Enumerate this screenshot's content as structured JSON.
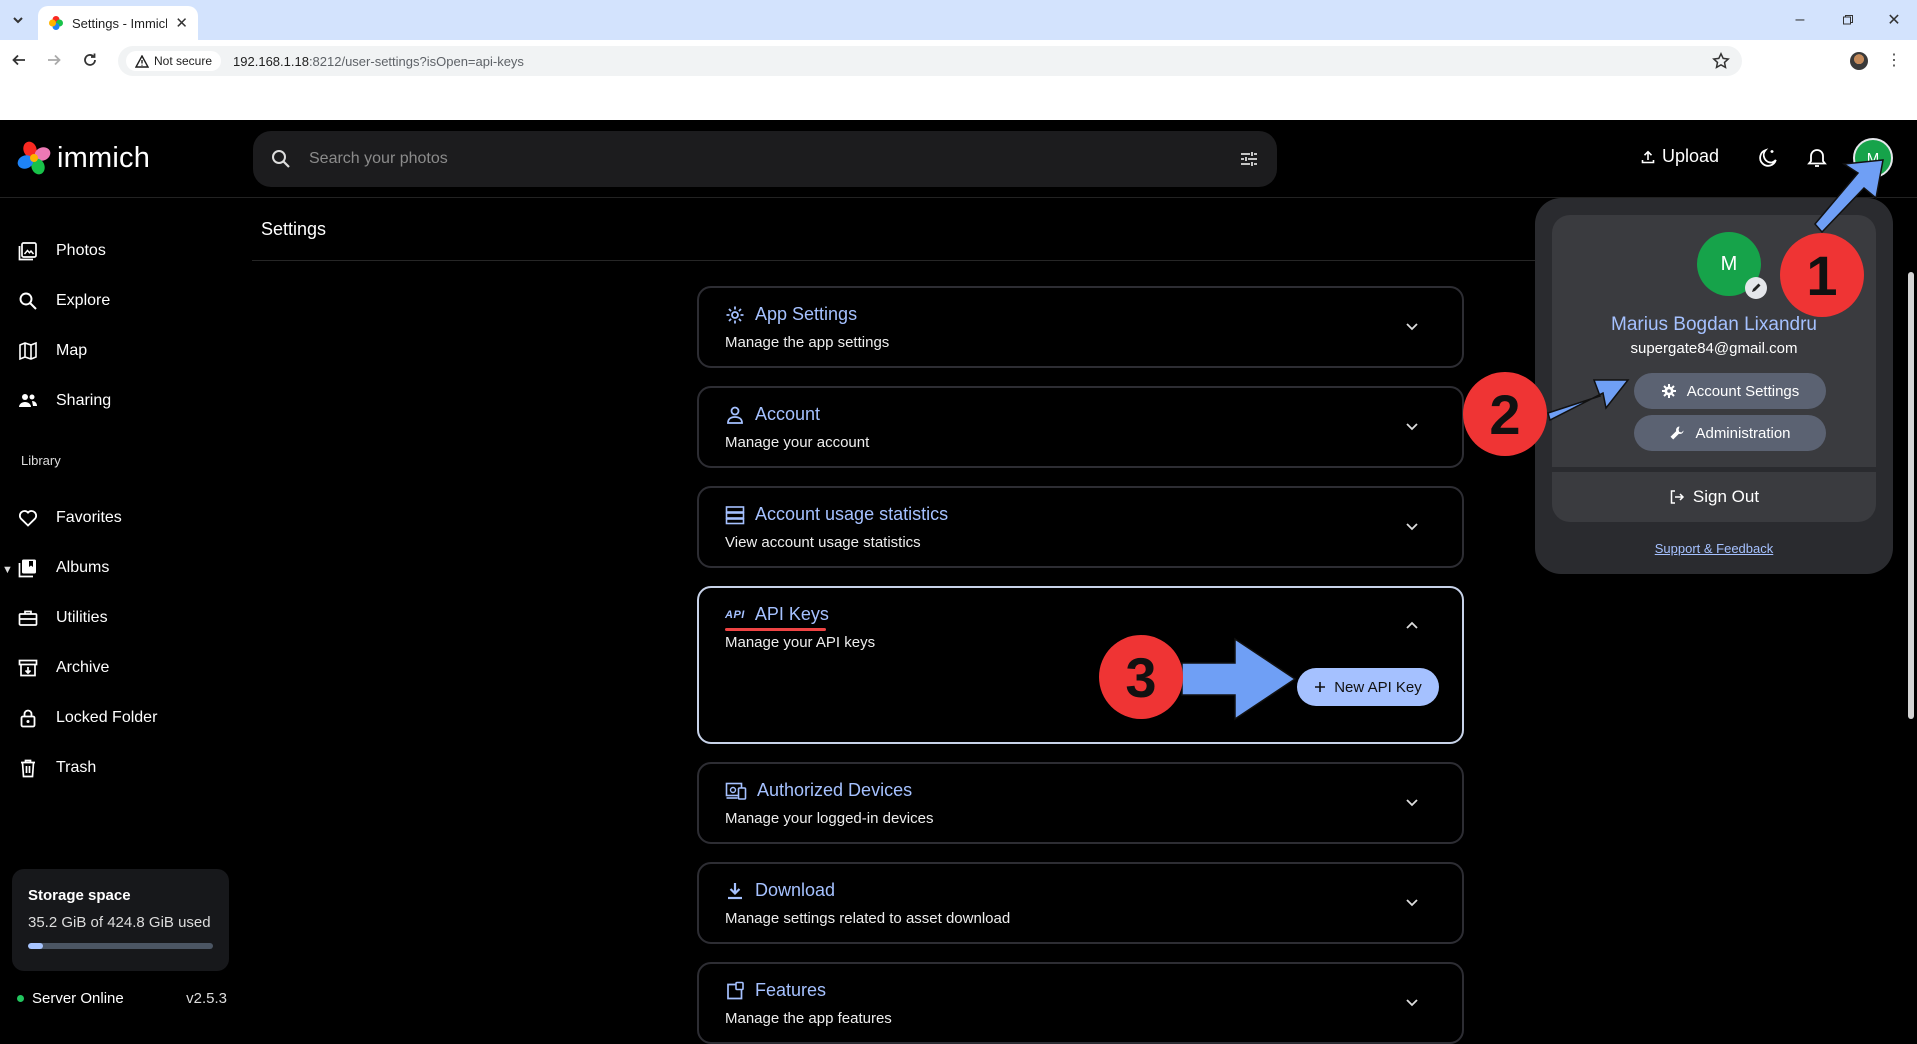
{
  "browser": {
    "tab_title": "Settings - Immich",
    "not_secure": "Not secure",
    "url_host": "192.168.1.18",
    "url_rest": ":8212/user-settings?isOpen=api-keys"
  },
  "header": {
    "logo_text": "immich",
    "search_placeholder": "Search your photos",
    "upload_label": "Upload",
    "avatar_initial": "M"
  },
  "sidebar": {
    "items": [
      {
        "label": "Photos"
      },
      {
        "label": "Explore"
      },
      {
        "label": "Map"
      },
      {
        "label": "Sharing"
      }
    ],
    "library_heading": "Library",
    "library_items": [
      {
        "label": "Favorites"
      },
      {
        "label": "Albums"
      },
      {
        "label": "Utilities"
      },
      {
        "label": "Archive"
      },
      {
        "label": "Locked Folder"
      },
      {
        "label": "Trash"
      }
    ],
    "storage": {
      "title": "Storage space",
      "used_text": "35.2 GiB of 424.8 GiB used",
      "used_fraction": 0.083
    },
    "server_status": "Server Online",
    "version": "v2.5.3"
  },
  "settings": {
    "title": "Settings",
    "sections": [
      {
        "title": "App Settings",
        "desc": "Manage the app settings"
      },
      {
        "title": "Account",
        "desc": "Manage your account"
      },
      {
        "title": "Account usage statistics",
        "desc": "View account usage statistics"
      },
      {
        "title": "API Keys",
        "desc": "Manage your API keys",
        "icon_text": "API"
      },
      {
        "title": "Authorized Devices",
        "desc": "Manage your logged-in devices"
      },
      {
        "title": "Download",
        "desc": "Manage settings related to asset download"
      },
      {
        "title": "Features",
        "desc": "Manage the app features"
      }
    ],
    "new_api_key_label": "New API Key"
  },
  "account_menu": {
    "avatar_initial": "M",
    "name": "Marius Bogdan Lixandru",
    "email": "supergate84@gmail.com",
    "account_settings_label": "Account Settings",
    "administration_label": "Administration",
    "sign_out_label": "Sign Out",
    "support_label": "Support & Feedback"
  },
  "annotations": {
    "step1": "1",
    "step2": "2",
    "step3": "3",
    "badge_color": "#ef3434",
    "arrow_color": "#6f9ff5"
  }
}
